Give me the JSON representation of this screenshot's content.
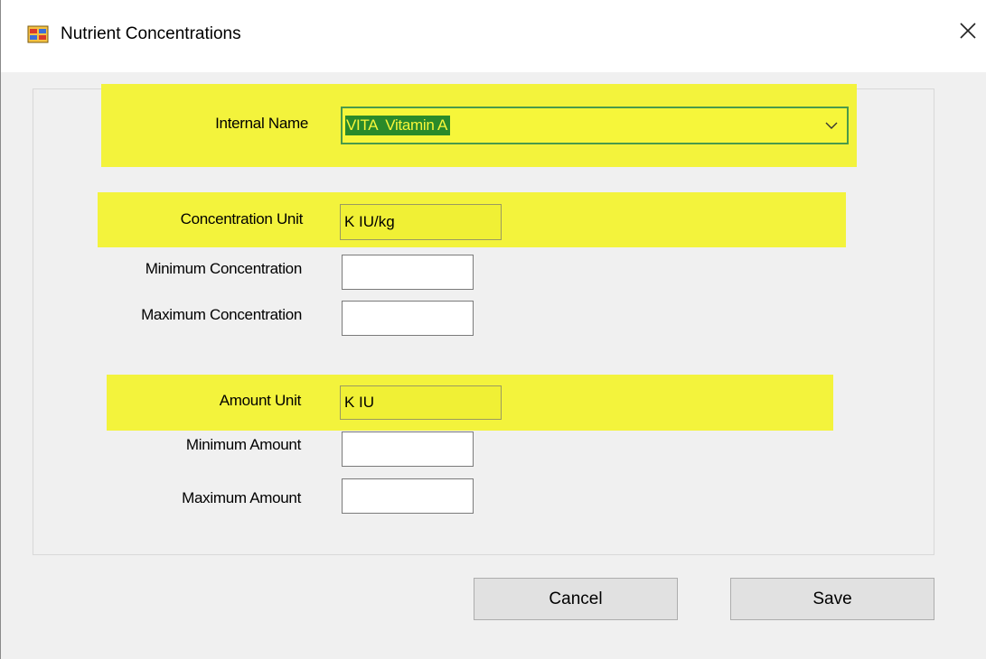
{
  "window": {
    "title": "Nutrient Concentrations",
    "icon": "app-form-icon",
    "close_icon": "close-icon"
  },
  "form": {
    "internal_name": {
      "label": "Internal Name",
      "value": "VITA  Vitamin A"
    },
    "concentration_unit": {
      "label": "Concentration Unit",
      "value": "K IU/kg"
    },
    "minimum_concentration": {
      "label": "Minimum Concentration",
      "value": ""
    },
    "maximum_concentration": {
      "label": "Maximum Concentration",
      "value": ""
    },
    "amount_unit": {
      "label": "Amount Unit",
      "value": "K IU"
    },
    "minimum_amount": {
      "label": "Minimum Amount",
      "value": ""
    },
    "maximum_amount": {
      "label": "Maximum Amount",
      "value": ""
    }
  },
  "buttons": {
    "cancel": "Cancel",
    "save": "Save"
  },
  "colors": {
    "highlight": "#f3f33c",
    "selection": "#2a8a2a",
    "background": "#f0f0f0"
  }
}
